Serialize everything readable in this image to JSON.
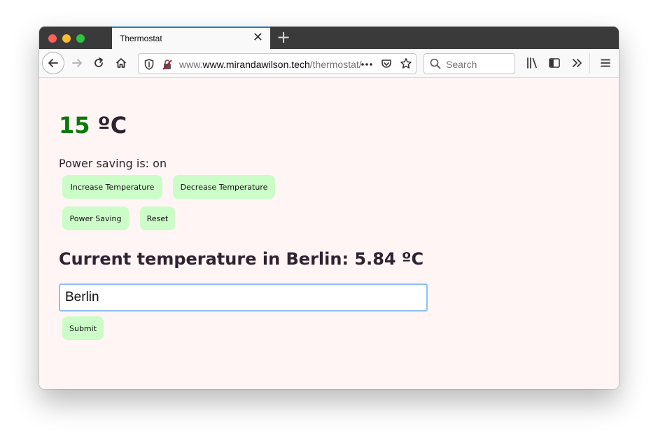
{
  "browser": {
    "tab_title": "Thermostat",
    "url_host": "www.mirandawilson.tech",
    "url_path": "/thermostat/",
    "search_placeholder": "Search"
  },
  "thermostat": {
    "temperature": "15",
    "unit": " ºC",
    "power_saving_text": "Power saving is: on",
    "increase_label": "Increase Temperature",
    "decrease_label": "Decrease Temperature",
    "power_saving_label": "Power Saving",
    "reset_label": "Reset"
  },
  "weather": {
    "heading": "Current temperature in Berlin: 5.84 ºC",
    "city_value": "Berlin",
    "submit_label": "Submit"
  },
  "colors": {
    "button_bg": "#ccfcc8",
    "temperature_green": "#0a7a0a",
    "page_bg": "#fff5f4"
  }
}
